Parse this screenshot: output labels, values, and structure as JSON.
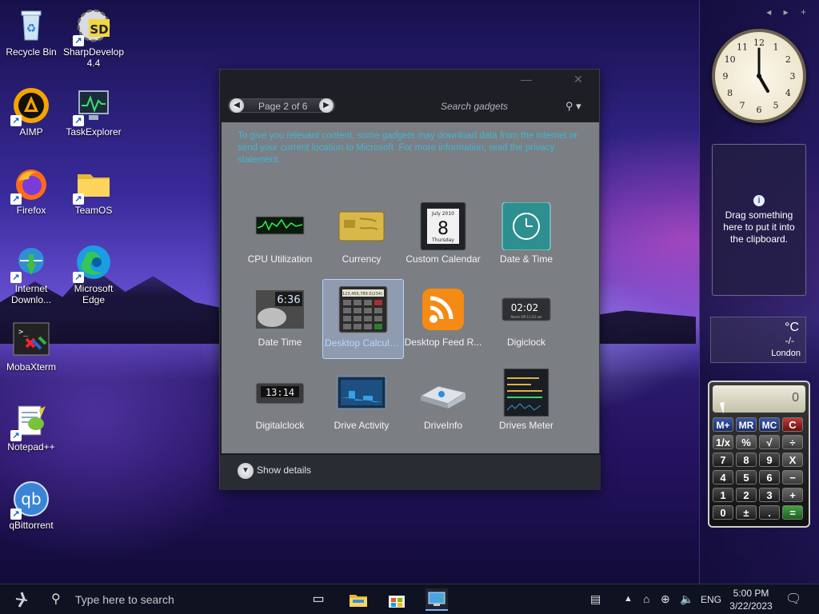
{
  "desktop": {
    "icons": [
      {
        "label": "Recycle Bin"
      },
      {
        "label": "SharpDevelop 4.4"
      },
      {
        "label": "AIMP"
      },
      {
        "label": "TaskExplorer"
      },
      {
        "label": "Firefox"
      },
      {
        "label": "TeamOS"
      },
      {
        "label": "Internet Downlo..."
      },
      {
        "label": "Microsoft Edge"
      },
      {
        "label": "MobaXterm"
      },
      {
        "label": "Notepad++"
      },
      {
        "label": "qBittorrent"
      }
    ]
  },
  "gallery": {
    "page_indicator": "Page 2 of 6",
    "search_placeholder": "Search gadgets",
    "notice": "To give you relevant content, some gadgets may download data from the internet or send your current location to Microsoft. For more information, read the privacy statement.",
    "gadgets": [
      {
        "name": "CPU Utilization"
      },
      {
        "name": "Currency"
      },
      {
        "name": "Custom Calendar"
      },
      {
        "name": "Date & Time"
      },
      {
        "name": "Date Time"
      },
      {
        "name": "Desktop Calculator"
      },
      {
        "name": "Desktop Feed R..."
      },
      {
        "name": "Digiclock"
      },
      {
        "name": "Digitalclock"
      },
      {
        "name": "Drive Activity"
      },
      {
        "name": "DriveInfo"
      },
      {
        "name": "Drives Meter"
      }
    ],
    "selected_gadget": "Desktop Calculator",
    "calendar_thumb": {
      "month": "July 2010",
      "day": "8",
      "weekday": "Thursday"
    },
    "digiclock_thumb": {
      "time": "02:02",
      "sub": "Alarm Off 11:03 am"
    },
    "datetime_thumb": "6:36",
    "digitalclock_thumb": "13:14",
    "calc_thumb_display": "123,456,789.0(234)",
    "show_details": "Show details"
  },
  "sidebar": {
    "controls": "◂ ▸ +",
    "clipboard_text": "Drag something here to put it into the clipboard.",
    "weather": {
      "unit": "°C",
      "value": "-/-",
      "city": "London"
    },
    "calculator": {
      "display": "0",
      "keys": [
        "M+",
        "MR",
        "MC",
        "C",
        "1/x",
        "%",
        "√",
        "÷",
        "7",
        "8",
        "9",
        "X",
        "4",
        "5",
        "6",
        "−",
        "1",
        "2",
        "3",
        "+",
        "0",
        "±",
        ".",
        "="
      ]
    },
    "clock": {
      "numerals": [
        "12",
        "1",
        "2",
        "3",
        "4",
        "5",
        "6",
        "7",
        "8",
        "9",
        "10",
        "11"
      ],
      "time": "5:00"
    }
  },
  "taskbar": {
    "search_placeholder": "Type here to search",
    "language": "ENG",
    "time": "5:00 PM",
    "date": "3/22/2023"
  }
}
